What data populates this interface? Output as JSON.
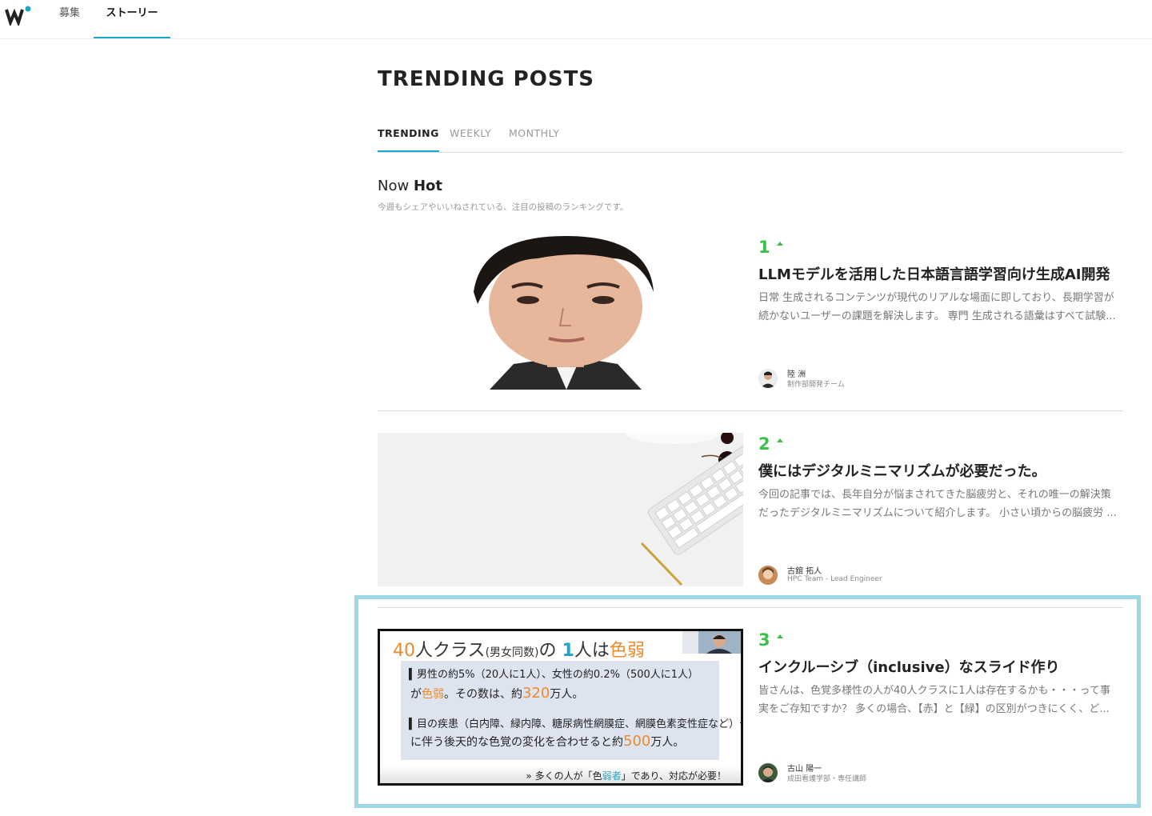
{
  "header": {
    "nav": [
      "募集",
      "ストーリー"
    ]
  },
  "page": {
    "title": "TRENDING POSTS",
    "tabs": [
      "TRENDING",
      "WEEKLY",
      "MONTHLY"
    ],
    "section_title_prefix": "Now",
    "section_title_bold": "Hot",
    "section_subtitle": "今週もシェアやいいねされている、注目の投稿のランキングです。"
  },
  "posts": [
    {
      "rank": "1",
      "title": "LLMモデルを活用した日本語言語学習向け生成AI開発",
      "excerpt_line1": "日常 生成されるコンテンツが現代のリアルな場面に即しており、長期学習が",
      "excerpt_line2": "続かないユーザーの課題を解決します。 専門 生成される語彙はすべて試験...",
      "author_name": "陸 洲",
      "author_role": "制作部開発チーム"
    },
    {
      "rank": "2",
      "title": "僕にはデジタルミニマリズムが必要だった。",
      "excerpt_line1": "今回の記事では、長年自分が悩まされてきた脳疲労と、それの唯一の解決策",
      "excerpt_line2": "だったデジタルミニマリズムについて紹介します。 小さい頃からの脳疲労 ...",
      "author_name": "古舘 拓人",
      "author_role": "HPC Team - Lead Engineer"
    },
    {
      "rank": "3",
      "title": "インクルーシブ（inclusive）なスライド作り",
      "excerpt_line1": "皆さんは、色覚多様性の人が40人クラスに1人は存在するかも・・・って事",
      "excerpt_line2": "実をご存知ですか？ 多くの場合、【赤】と【緑】の区別がつきにくく、ど...",
      "author_name": "古山 陽一",
      "author_role": "成田看護学部・専任講師",
      "slide": {
        "head_num": "40",
        "head_a": "人クラス",
        "head_b": "(男女同数)",
        "head_c": "の",
        "head_one": "1",
        "head_d": "人は",
        "head_e": "色弱",
        "l1": "▍男性の約5%（20人に1人）、女性の約0.2%（500人に1人）",
        "l2a": "が",
        "l2b": "色弱",
        "l2c": "。その数は、約",
        "l2d": "320",
        "l2e": "万人。",
        "l3": "▍目の疾患（白内障、緑内障、糖尿病性網膜症、網膜色素変性症など）や加齢",
        "l4a": "に伴う後天的な色覚の変化を合わせると約",
        "l4b": "500",
        "l4c": "万人。",
        "foot_a": "» 多くの人が「色",
        "foot_b": "弱者",
        "foot_c": "」であり、対応が必要！"
      }
    }
  ],
  "colors": {
    "accent": "#1aa7c8",
    "rank_green": "#3cc04b",
    "highlight_border": "#9dd8e6",
    "slide_orange": "#ee8a2c"
  },
  "icons": {
    "logo": "wantedly-logo-icon",
    "rank_up": "triangle-up-icon"
  }
}
